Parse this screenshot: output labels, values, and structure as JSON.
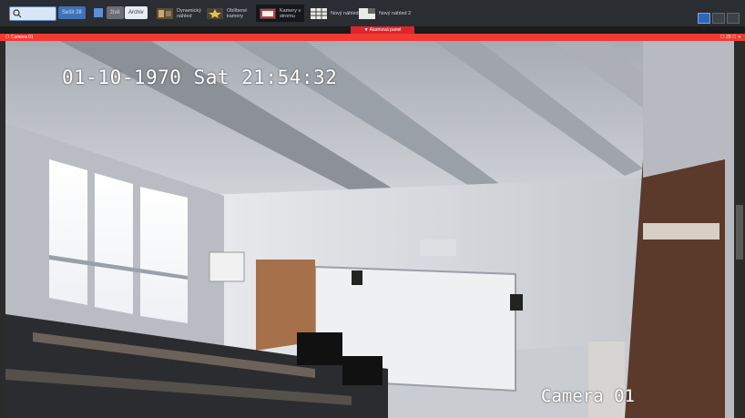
{
  "toolbar": {
    "search_placeholder": "",
    "btn1_label": "Sešit 28",
    "btn2_label": "živě",
    "btn3_label": "Archiv",
    "items": [
      {
        "label1": "Dynamický",
        "label2": "náhled"
      },
      {
        "label1": "Oblíbené",
        "label2": "kamery"
      },
      {
        "label1": "Kamery v",
        "label2": "stromu"
      },
      {
        "label1": "Nový náhled 1",
        "label2": ""
      },
      {
        "label1": "Nový náhled 2",
        "label2": ""
      }
    ]
  },
  "alarm_tab": "▼ Alarmová panel",
  "red_bar": {
    "left": "☐ Camera 01",
    "right": "☐ 28 ☐ ✕"
  },
  "video": {
    "osd_time": "01-10-1970 Sat 21:54:32",
    "osd_camera": "Camera 01"
  }
}
